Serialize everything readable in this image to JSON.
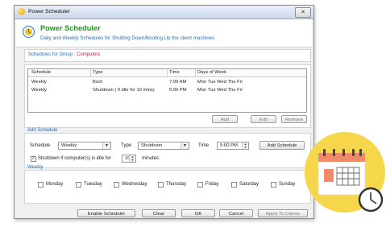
{
  "window": {
    "title": "Power Scheduler",
    "close_glyph": "✕"
  },
  "header": {
    "title": "Power Scheduler",
    "subtitle": "Daily and Weekly Schedules for Shutting Down/Booting Up the client machines"
  },
  "group": {
    "label": "Schedules for Group :",
    "value": "Computers"
  },
  "schedules": {
    "columns": [
      "Schedule",
      "Type",
      "Time",
      "Days of Week"
    ],
    "rows": [
      [
        "Weekly",
        "Boot",
        "7:00 AM",
        "Mon Tue Wed Thu Fri"
      ],
      [
        "Weekly",
        "Shutdown ( if idle for 10 mins)",
        "5:00 PM",
        "Mon Tue Wed Thu Fri"
      ]
    ],
    "add_label": "Add",
    "edit_label": "Edit",
    "remove_label": "Remove"
  },
  "add_schedule": {
    "section_label": "Add Schedule",
    "schedule_label": "Schedule",
    "schedule_value": "Weekly",
    "type_label": "Type",
    "type_value": "Shutdown",
    "time_label": "Time",
    "time_value": "5:00 PM",
    "add_button": "Add Schedule",
    "idle_checkbox_label": "Shutdown if computer(s) is idle for",
    "idle_checked": true,
    "idle_value": "10",
    "idle_unit": "minutes"
  },
  "weekly": {
    "section_label": "Weekly",
    "days": [
      "Monday",
      "Tuesday",
      "Wednesday",
      "Thursday",
      "Friday",
      "Saturday",
      "Sunday"
    ]
  },
  "footer": {
    "enable": "Enable Scheduler",
    "clear": "Clear",
    "ok": "OK",
    "cancel": "Cancel",
    "apply": "Apply To Clients"
  },
  "icons": {
    "app": "power-scheduler-icon",
    "calendar": "calendar-clock-icon"
  },
  "colors": {
    "title_green": "#1a9a1a",
    "link_blue": "#2a6fb0",
    "group_red": "#d01b3a",
    "calendar_bg": "#f6d64a",
    "calendar_accent": "#f08a6a"
  }
}
